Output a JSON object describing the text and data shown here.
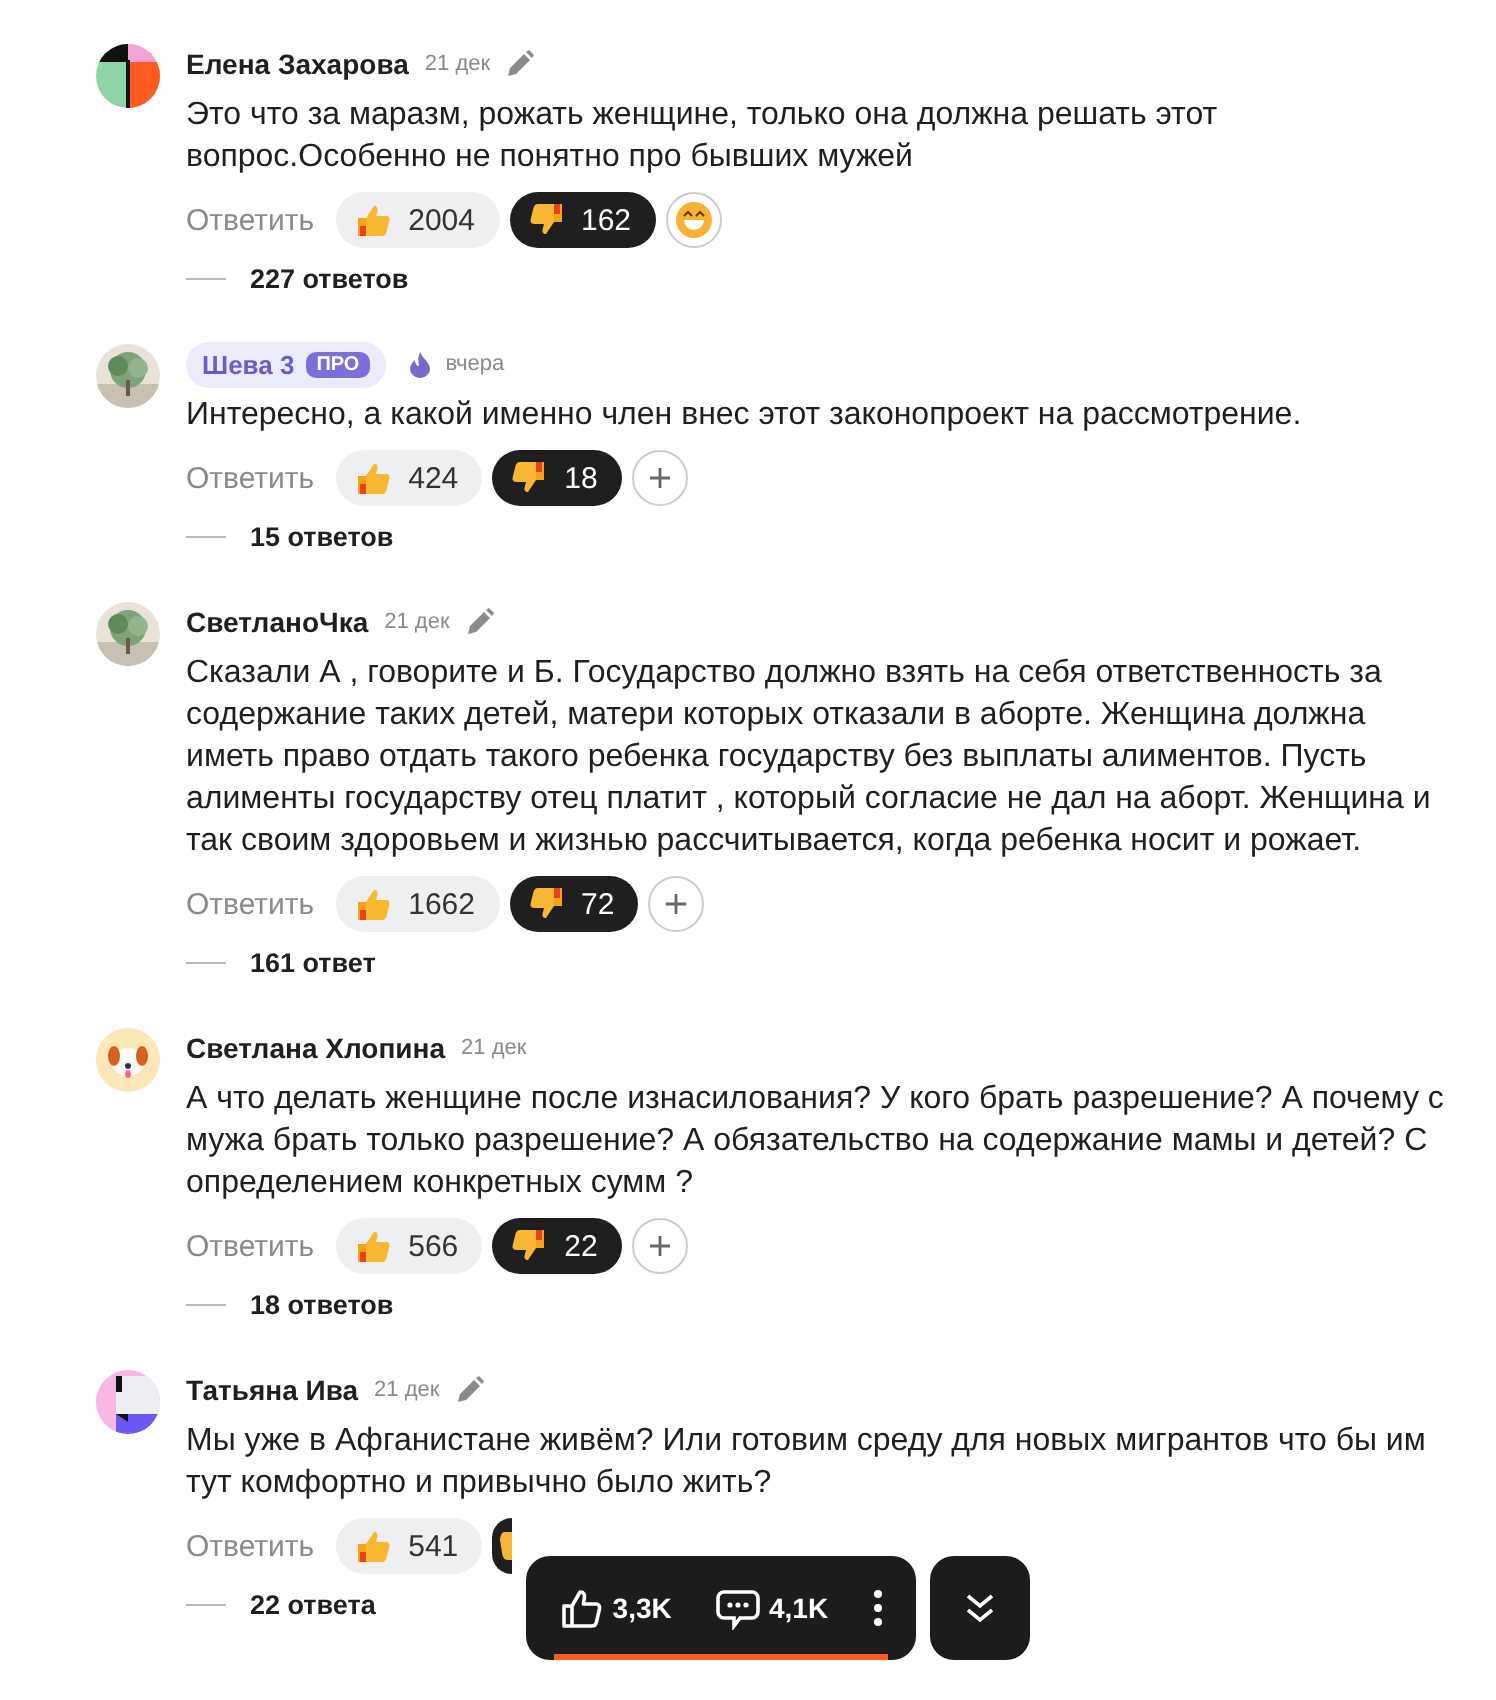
{
  "comments": [
    {
      "author": "Елена Захарова",
      "avatar": {
        "kind": "pattern"
      },
      "date": "21 дек",
      "date_icon": {
        "kind": "pencil"
      },
      "text": "Это что за маразм, рожать женщине, только она должна решать этот вопрос.Особенно не понятно про бывших мужей",
      "reply": "Ответить",
      "likes": "2004",
      "liked": false,
      "dislikes": "162",
      "disliked": true,
      "extra_button": {
        "kind": "emoji"
      },
      "replies": "227 ответов"
    },
    {
      "author": "Шева 3",
      "badge": "ПРО",
      "date": "вчера",
      "date_icon": {
        "kind": "flame"
      },
      "text": "Интересно, а какой именно член внес этот законопроект на рассмотрение.",
      "reply": "Ответить",
      "likes": "424",
      "liked": false,
      "dislikes": "18",
      "disliked": true,
      "extra_button": {
        "kind": "plus"
      },
      "replies": "15 ответов"
    },
    {
      "author": "СветланоЧка",
      "date": "21 дек",
      "date_icon": {
        "kind": "pencil"
      },
      "text": "Сказали А , говорите и Б. Государство должно взять на себя ответственность за содержание таких детей, матери которых отказали в аборте. Женщина должна иметь право отдать такого ребенка государству без выплаты алиментов. Пусть алименты государству отец платит , который согласие не дал на аборт. Женщина и так своим здоровьем и жизнью рассчитывается, когда ребенка носит и рожает.",
      "reply": "Ответить",
      "likes": "1662",
      "liked": false,
      "dislikes": "72",
      "disliked": true,
      "extra_button": {
        "kind": "plus"
      },
      "replies": "161 ответ"
    },
    {
      "author": "Светлана Хлопина",
      "avatar": {
        "kind": "animal"
      },
      "date": "21 дек",
      "text": "А что делать женщине после изнасилования? У кого брать разрешение? А почему с мужа брать только разрешение? А обязательство на содержание мамы и детей? С определением конкретных сумм ?",
      "reply": "Ответить",
      "likes": "566",
      "liked": false,
      "dislikes": "22",
      "disliked": true,
      "extra_button": {
        "kind": "plus"
      },
      "replies": "18 ответов"
    },
    {
      "author": "Татьяна Ива",
      "avatar": {
        "kind": "pattern2"
      },
      "date": "21 дек",
      "date_icon": {
        "kind": "pencil"
      },
      "text": "Мы уже в Афганистане живём? Или готовим среду для новых мигрантов что бы им тут комфортно и привычно было жить?",
      "reply": "Ответить",
      "likes": "541",
      "liked": false,
      "disliked": true,
      "replies": "22 ответа"
    }
  ],
  "floating_bar": {
    "likes": "3,3K",
    "comments": "4,1K"
  }
}
